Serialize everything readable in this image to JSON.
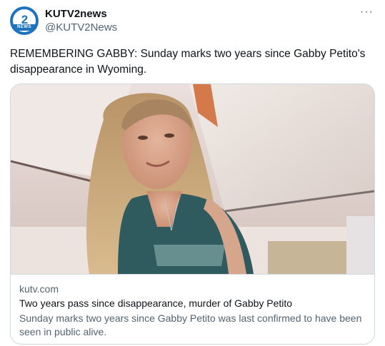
{
  "author": {
    "name": "KUTV2news",
    "handle": "@KUTV2News",
    "avatar": {
      "number": "2",
      "band_text": "NEWS"
    }
  },
  "more_icon": "···",
  "tweet_text": "REMEMBERING GABBY: Sunday marks two years since Gabby Petito's disappearance in Wyoming.",
  "card": {
    "domain": "kutv.com",
    "title": "Two years pass since disappearance, murder of Gabby Petito",
    "description": "Sunday marks two years since Gabby Petito was last confirmed to have been seen in public alive."
  },
  "colors": {
    "accent": "#1e73bd",
    "text": "#0f1419",
    "muted": "#536471",
    "border": "#cfd9de"
  }
}
